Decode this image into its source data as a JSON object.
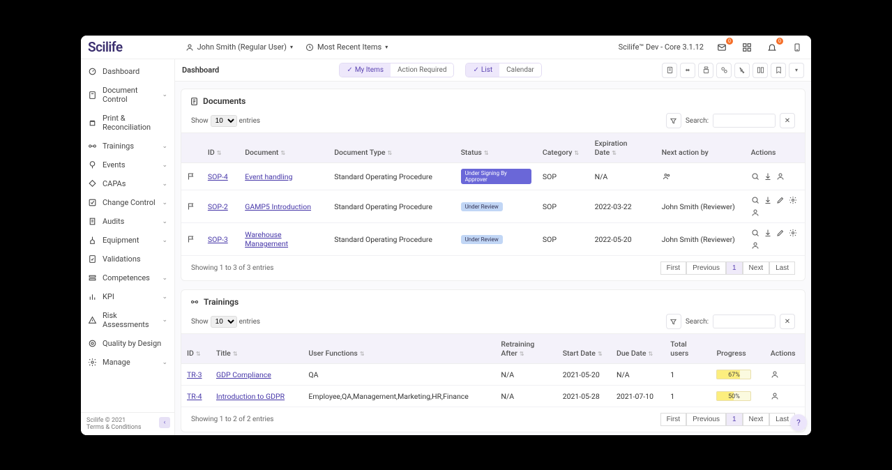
{
  "header": {
    "brand": "Scilife",
    "user_label": "John Smith (Regular User)",
    "recent_label": "Most Recent Items",
    "version": "Scilife™ Dev - Core 3.1.12",
    "mail_badge": "0",
    "bell_badge": "0"
  },
  "sidebar": {
    "items": [
      {
        "label": "Dashboard",
        "chevron": false
      },
      {
        "label": "Document Control",
        "chevron": true
      },
      {
        "label": "Print & Reconciliation",
        "chevron": false
      },
      {
        "label": "Trainings",
        "chevron": true
      },
      {
        "label": "Events",
        "chevron": true
      },
      {
        "label": "CAPAs",
        "chevron": true
      },
      {
        "label": "Change Control",
        "chevron": true
      },
      {
        "label": "Audits",
        "chevron": true
      },
      {
        "label": "Equipment",
        "chevron": true
      },
      {
        "label": "Validations",
        "chevron": false
      },
      {
        "label": "Competences",
        "chevron": true
      },
      {
        "label": "KPI",
        "chevron": true
      },
      {
        "label": "Risk Assessments",
        "chevron": true
      },
      {
        "label": "Quality by Design",
        "chevron": false
      },
      {
        "label": "Manage",
        "chevron": true
      }
    ],
    "footer_line1": "Scilife © 2021",
    "footer_line2": "Terms & Conditions"
  },
  "subbar": {
    "breadcrumb": "Dashboard",
    "seg1": {
      "my_items": "My Items",
      "action_required": "Action Required"
    },
    "seg2": {
      "list": "List",
      "calendar": "Calendar"
    }
  },
  "documents": {
    "title": "Documents",
    "show_label": "Show",
    "show_value": "10",
    "entries_label": "entries",
    "search_label": "Search:",
    "columns": {
      "id": "ID",
      "document": "Document",
      "doc_type": "Document Type",
      "status": "Status",
      "category": "Category",
      "expiration": "Expiration Date",
      "next_action": "Next action by",
      "actions": "Actions"
    },
    "rows": [
      {
        "id": "SOP-4",
        "document": "Event handling",
        "doc_type": "Standard Operating Procedure",
        "status": "Under Signing By Approver",
        "status_style": "blue",
        "category": "SOP",
        "expiration": "N/A",
        "next_action_icon": true,
        "next_action_text": "",
        "action_set": "basic"
      },
      {
        "id": "SOP-2",
        "document": "GAMP5 Introduction",
        "doc_type": "Standard Operating Procedure",
        "status": "Under Review",
        "status_style": "light",
        "category": "SOP",
        "expiration": "2022-03-22",
        "next_action_icon": false,
        "next_action_text": "John Smith (Reviewer)",
        "action_set": "full"
      },
      {
        "id": "SOP-3",
        "document": "Warehouse Management",
        "doc_type": "Standard Operating Procedure",
        "status": "Under Review",
        "status_style": "light",
        "category": "SOP",
        "expiration": "2022-05-20",
        "next_action_icon": false,
        "next_action_text": "John Smith (Reviewer)",
        "action_set": "full"
      }
    ],
    "footer_info": "Showing 1 to 3 of 3 entries",
    "pager": {
      "first": "First",
      "previous": "Previous",
      "page": "1",
      "next": "Next",
      "last": "Last"
    }
  },
  "trainings": {
    "title": "Trainings",
    "show_label": "Show",
    "show_value": "10",
    "entries_label": "entries",
    "search_label": "Search:",
    "columns": {
      "id": "ID",
      "title": "Title",
      "user_functions": "User Functions",
      "retraining": "Retraining After",
      "start": "Start Date",
      "due": "Due Date",
      "total": "Total users",
      "progress": "Progress",
      "actions": "Actions"
    },
    "rows": [
      {
        "id": "TR-3",
        "title": "GDP Compliance",
        "user_functions": "QA",
        "retraining": "N/A",
        "start": "2021-05-20",
        "due": "N/A",
        "total": "1",
        "progress_label": "67%",
        "progress_pct": 67
      },
      {
        "id": "TR-4",
        "title": "Introduction to GDPR",
        "user_functions": "Employee,QA,Management,Marketing,HR,Finance",
        "retraining": "N/A",
        "start": "2021-05-28",
        "due": "2021-07-10",
        "total": "1",
        "progress_label": "50%",
        "progress_pct": 50
      }
    ],
    "footer_info": "Showing 1 to 2 of 2 entries",
    "pager": {
      "first": "First",
      "previous": "Previous",
      "page": "1",
      "next": "Next",
      "last": "Last"
    }
  }
}
